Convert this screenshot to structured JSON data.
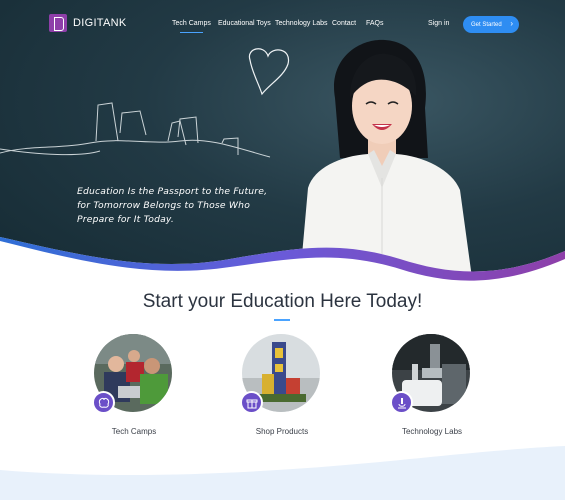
{
  "brand": {
    "name": "DIGITANK",
    "accent": "#8e3fa9"
  },
  "nav": {
    "links": [
      "Tech Camps",
      "Educational Toys",
      "Technology Labs",
      "Contact",
      "FAQs"
    ],
    "active": "Tech Camps",
    "sign_in": "Sign in",
    "cta": "Get Started",
    "cta_color": "#2e8df2"
  },
  "hero": {
    "tagline": [
      "Education Is the Passport to the Future,",
      "for Tomorrow Belongs to Those Who",
      "Prepare for It Today."
    ]
  },
  "section": {
    "title": "Start your Education Here Today!",
    "cards": [
      {
        "label": "Tech Camps",
        "icon": "brain-icon"
      },
      {
        "label": "Shop Products",
        "icon": "gift-box-icon"
      },
      {
        "label": "Technology Labs",
        "icon": "microscope-icon"
      }
    ]
  },
  "colors": {
    "wave_start": "#3d7be0",
    "wave_end": "#8e3fa9",
    "badge": "#6b4fc8"
  }
}
